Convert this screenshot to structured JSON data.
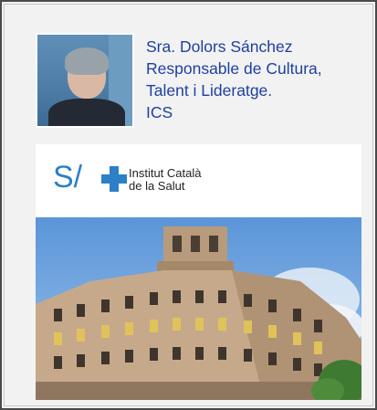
{
  "profile": {
    "name": "Sra. Dolors Sánchez",
    "role_line1": "Responsable de Cultura,",
    "role_line2": "Talent i Lideratge.",
    "organization": "ICS"
  },
  "logo": {
    "mark": "S/",
    "line1": "Institut Català",
    "line2": "de la Salut"
  },
  "colors": {
    "link_text": "#1f3f9f",
    "logo_blue": "#2d7fc8"
  }
}
